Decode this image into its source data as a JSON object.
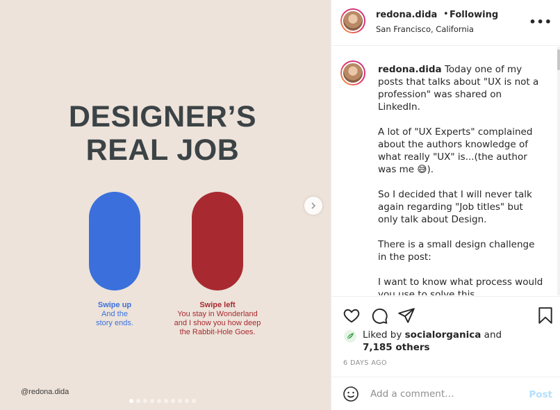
{
  "slide": {
    "title_line1": "DESIGNER’S",
    "title_line2": "REAL JOB",
    "blue": {
      "heading": "Swipe up",
      "line1": "And the",
      "line2": "story ends."
    },
    "red": {
      "heading": "Swipe left",
      "line1": "You stay in Wonderland",
      "line2": "and I show you how deep",
      "line3": "the Rabbit-Hole Goes."
    },
    "handle": "@redona.dida",
    "dots_total": 10,
    "dots_active_index": 0
  },
  "header": {
    "username": "redona.dida",
    "separator": "•",
    "follow_status": "Following",
    "location": "San Francisco, California",
    "more": "•••"
  },
  "caption": {
    "username": "redona.dida",
    "p1": "Today one of my posts that talks about \"UX is not a profession\" was shared on LinkedIn.",
    "p2": "A lot of \"UX Experts\" complained about the authors knowledge of what really \"UX\" is...(the author was me 😅).",
    "p3": "So I decided that I will never talk again regarding \"Job titles\" but only talk about Design.",
    "p4": "There is a small design challenge in the post:",
    "p5": "I want to know what process would you use to solve this"
  },
  "likes": {
    "prefix": "Liked by",
    "user": "socialorganica",
    "and": "and",
    "others": "7,185 others"
  },
  "timestamp": "6 DAYS AGO",
  "comment_box": {
    "placeholder": "Add a comment…",
    "post_label": "Post"
  },
  "colors": {
    "blue": "#3b70dc",
    "red": "#a82a30",
    "bg": "#ede3da",
    "title": "#3c4346"
  }
}
